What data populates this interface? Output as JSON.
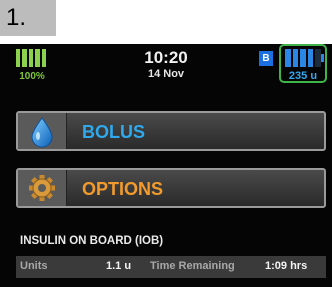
{
  "step_label": "1.",
  "status_bar": {
    "pump_battery_percent": "100%",
    "time": "10:20",
    "date": "14 Nov",
    "bluetooth_badge": "B",
    "insulin_remaining": "235 u"
  },
  "menu": {
    "bolus_label": "BOLUS",
    "options_label": "OPTIONS"
  },
  "iob": {
    "title": "INSULIN ON BOARD (IOB)",
    "units_label": "Units",
    "units_value": "1.1 u",
    "time_remaining_label": "Time Remaining",
    "time_remaining_value": "1:09 hrs"
  },
  "colors": {
    "bolus_accent": "#2fa8ec",
    "options_accent": "#f29b2c",
    "battery_green": "#8dd24e",
    "cartridge_blue": "#2a87e6",
    "highlight_green": "#3fb449"
  },
  "icons": {
    "bolus": "insulin-drop-icon",
    "options": "gear-icon"
  }
}
